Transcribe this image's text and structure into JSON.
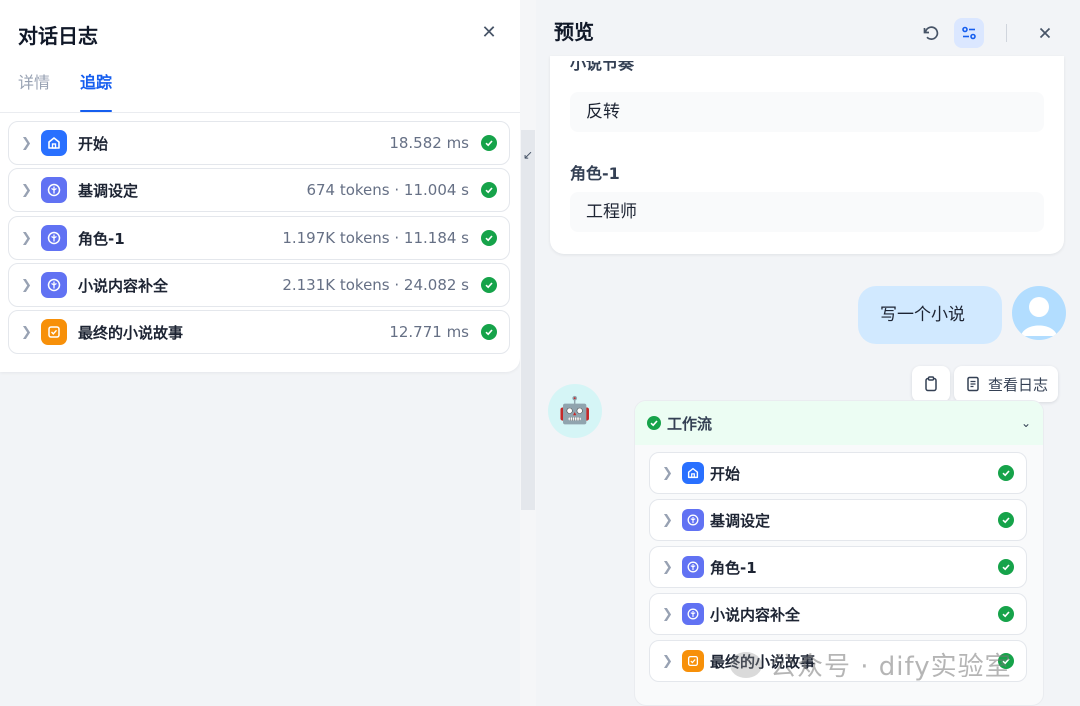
{
  "left": {
    "title": "对话日志",
    "close_icon": "close-icon",
    "tabs": [
      {
        "label": "详情",
        "active": false
      },
      {
        "label": "追踪",
        "active": true
      }
    ],
    "trace": [
      {
        "title": "开始",
        "meta": "18.582 ms",
        "icon": "home-icon",
        "color": "#2970ff"
      },
      {
        "title": "基调设定",
        "meta": "674 tokens · 11.004 s",
        "icon": "llm-icon",
        "color": "#6172f3"
      },
      {
        "title": "角色-1",
        "meta": "1.197K tokens · 11.184 s",
        "icon": "llm-icon",
        "color": "#6172f3"
      },
      {
        "title": "小说内容补全",
        "meta": "2.131K tokens · 24.082 s",
        "icon": "llm-icon",
        "color": "#6172f3"
      },
      {
        "title": "最终的小说故事",
        "meta": "12.771 ms",
        "icon": "end-icon",
        "color": "#f79009"
      }
    ]
  },
  "right": {
    "title": "预览",
    "vars": [
      {
        "label": "小说节奏",
        "value": "反转"
      },
      {
        "label": "角色-1",
        "value": "工程师"
      }
    ],
    "user_message": "写一个小说",
    "view_log_label": "查看日志",
    "workflow": {
      "title": "工作流",
      "nodes": [
        {
          "title": "开始",
          "icon": "home-icon",
          "color": "#2970ff"
        },
        {
          "title": "基调设定",
          "icon": "llm-icon",
          "color": "#6172f3"
        },
        {
          "title": "角色-1",
          "icon": "llm-icon",
          "color": "#6172f3"
        },
        {
          "title": "小说内容补全",
          "icon": "llm-icon",
          "color": "#6172f3"
        },
        {
          "title": "最终的小说故事",
          "icon": "end-icon",
          "color": "#f79009"
        }
      ]
    }
  },
  "watermark": "公众号 · dify实验室",
  "colors": {
    "success": "#16a34a",
    "accent": "#155eef",
    "user_bubble": "#d1e9ff"
  }
}
